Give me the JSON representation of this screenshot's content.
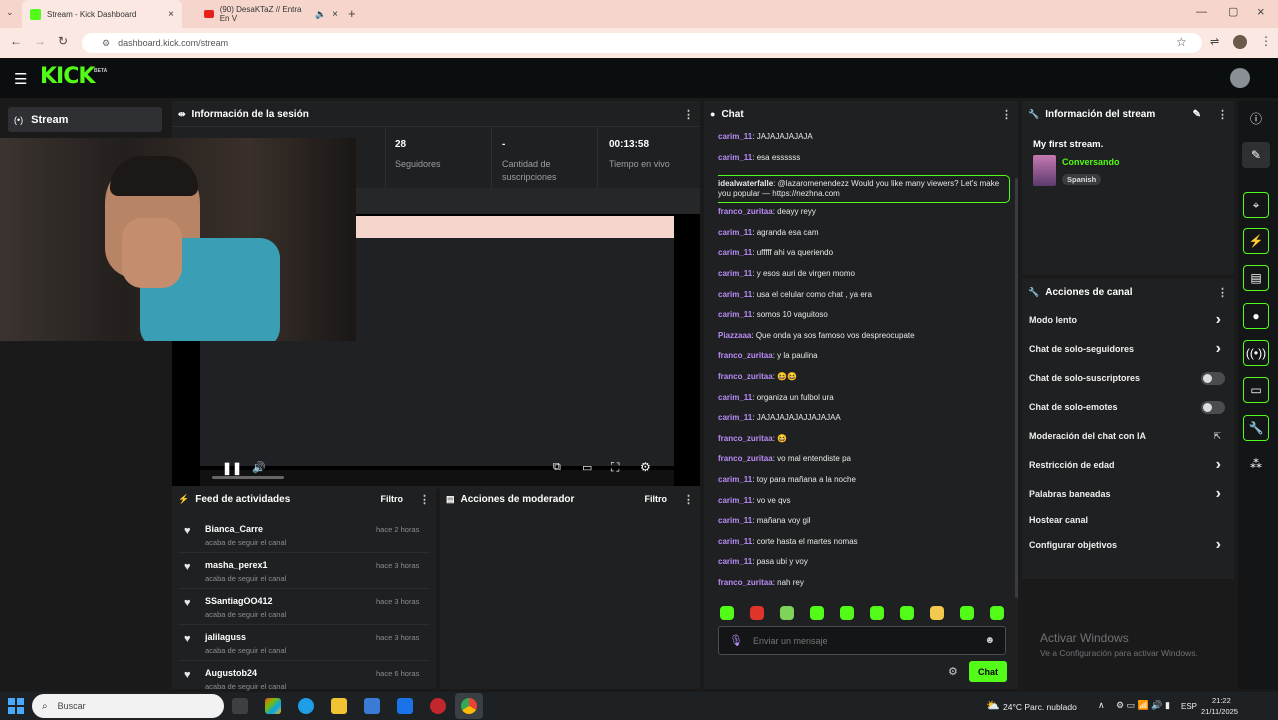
{
  "browser": {
    "tabs": [
      {
        "title": "Stream - Kick Dashboard",
        "active": true
      },
      {
        "title": "(90) DesaKTaZ // Entra En V",
        "active": false
      }
    ],
    "url": "dashboard.kick.com/stream"
  },
  "kick": {
    "logo": "KICK",
    "logo_tag": "BETA",
    "nav_stream": "Stream"
  },
  "session": {
    "title": "Información de la sesión",
    "stats": [
      {
        "value": "28",
        "label": "Seguidores"
      },
      {
        "value": "-",
        "label": "Cantidad de suscripciones"
      },
      {
        "value": "00:13:58",
        "label": "Tiempo en vivo"
      }
    ]
  },
  "chat": {
    "title": "Chat",
    "messages": [
      {
        "user": "carim_11",
        "text": "JAJAJAJAJAJA",
        "color": "#b98cf7"
      },
      {
        "user": "carim_11",
        "text": "esa essssss",
        "color": "#b98cf7"
      },
      {
        "user": "idealwaterfalle",
        "text": "@lazaromenendezz Would you like many viewers? Let's make you popular — https://nezhna.com",
        "color": "#e8e8e8",
        "highlight": true
      },
      {
        "user": "franco_zuritaa",
        "text": "deayy reyy",
        "color": "#b98cf7"
      },
      {
        "user": "carim_11",
        "text": "agranda esa cam",
        "color": "#b98cf7"
      },
      {
        "user": "carim_11",
        "text": "ufffff ahi va queriendo",
        "color": "#b98cf7"
      },
      {
        "user": "carim_11",
        "text": "y esos auri de virgen momo",
        "color": "#b98cf7"
      },
      {
        "user": "carim_11",
        "text": "usa el celular como chat , ya era",
        "color": "#b98cf7"
      },
      {
        "user": "carim_11",
        "text": "somos 10 vaguitoso",
        "color": "#b98cf7"
      },
      {
        "user": "Piazzaaa",
        "text": "Que onda ya sos famoso vos despreocupate",
        "color": "#b98cf7"
      },
      {
        "user": "franco_zuritaa",
        "text": "y la paulina",
        "color": "#b98cf7"
      },
      {
        "user": "franco_zuritaa",
        "text": "😆😆",
        "color": "#b98cf7"
      },
      {
        "user": "carim_11",
        "text": "organiza un fulbol ura",
        "color": "#b98cf7"
      },
      {
        "user": "carim_11",
        "text": "JAJAJAJAJAJJAJAJAA",
        "color": "#b98cf7"
      },
      {
        "user": "franco_zuritaa",
        "text": "😆",
        "color": "#b98cf7"
      },
      {
        "user": "franco_zuritaa",
        "text": "vo mal entendiste pa",
        "color": "#b98cf7"
      },
      {
        "user": "carim_11",
        "text": "toy para mañana a la noche",
        "color": "#b98cf7"
      },
      {
        "user": "carim_11",
        "text": "vo ve qvs",
        "color": "#b98cf7"
      },
      {
        "user": "carim_11",
        "text": "mañana voy gil",
        "color": "#b98cf7"
      },
      {
        "user": "carim_11",
        "text": "corte hasta el martes nomas",
        "color": "#b98cf7"
      },
      {
        "user": "carim_11",
        "text": "pasa ubi y voy",
        "color": "#b98cf7"
      },
      {
        "user": "franco_zuritaa",
        "text": "nah rey",
        "color": "#b98cf7"
      }
    ],
    "input_placeholder": "Enviar un mensaje",
    "send_label": "Chat"
  },
  "stream_info": {
    "title": "Información del stream",
    "stream_title": "My first stream.",
    "category": "Conversando",
    "language": "Spanish"
  },
  "channel_actions": {
    "title": "Acciones de canal",
    "items": [
      {
        "label": "Modo lento",
        "control": "chevron"
      },
      {
        "label": "Chat de solo-seguidores",
        "control": "chevron"
      },
      {
        "label": "Chat de solo-suscriptores",
        "control": "toggle"
      },
      {
        "label": "Chat de solo-emotes",
        "control": "toggle"
      },
      {
        "label": "Moderación del chat con IA",
        "control": "external"
      },
      {
        "label": "Restricción de edad",
        "control": "chevron"
      },
      {
        "label": "Palabras baneadas",
        "control": "chevron"
      },
      {
        "label": "Hostear canal",
        "control": "none"
      },
      {
        "label": "Configurar objetivos",
        "control": "chevron"
      }
    ]
  },
  "activity_feed": {
    "title": "Feed de actividades",
    "filter_label": "Filtro",
    "items": [
      {
        "name": "Bianca_Carre",
        "action": "acaba de seguir el canal",
        "time": "hace 2 horas"
      },
      {
        "name": "masha_perex1",
        "action": "acaba de seguir el canal",
        "time": "hace 3 horas"
      },
      {
        "name": "SSantiagOO412",
        "action": "acaba de seguir el canal",
        "time": "hace 3 horas"
      },
      {
        "name": "jalilaguss",
        "action": "acaba de seguir el canal",
        "time": "hace 3 horas"
      },
      {
        "name": "Augustob24",
        "action": "acaba de seguir el canal",
        "time": "hace 6 horas"
      }
    ]
  },
  "mod_actions": {
    "title": "Acciones de moderador",
    "filter_label": "Filtro"
  },
  "watermark": {
    "line1": "Activar Windows",
    "line2": "Ve a Configuración para activar Windows."
  },
  "taskbar": {
    "search_placeholder": "Buscar",
    "weather": "24°C  Parc. nublado",
    "lang": "ESP",
    "time": "21:22",
    "date": "21/11/2025"
  },
  "colors": {
    "accent": "#53fc18",
    "username": "#b98cf7"
  }
}
